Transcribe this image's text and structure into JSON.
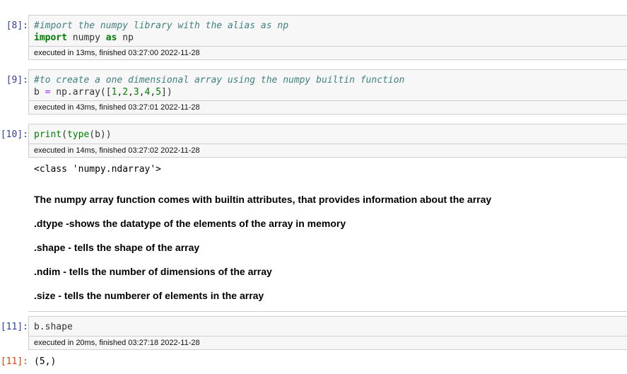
{
  "cells": [
    {
      "prompt": "[8]:",
      "comment": "#import the numpy library with the alias as np",
      "kw_import": "import",
      "mod": " numpy ",
      "kw_as": "as",
      "alias": " np",
      "exec": "executed in 13ms, finished 03:27:00 2022-11-28"
    },
    {
      "prompt": "[9]:",
      "comment": "#to create a one dimensional array using the numpy builtin function",
      "var": "b ",
      "op": "=",
      "call": " np.array([",
      "n1": "1",
      "n2": "2",
      "n3": "3",
      "n4": "4",
      "n5": "5",
      "comma": ",",
      "close": "])",
      "exec": "executed in 43ms, finished 03:27:01 2022-11-28"
    },
    {
      "prompt": "[10]:",
      "fn_print": "print",
      "open": "(",
      "fn_type": "type",
      "rest": "(b))",
      "exec": "executed in 14ms, finished 03:27:02 2022-11-28",
      "output": "<class 'numpy.ndarray'>"
    },
    {
      "prompt": "[11]:",
      "code": "b.shape",
      "exec": "executed in 20ms, finished 03:27:18 2022-11-28",
      "out_prompt": "[11]:",
      "output": "(5,)"
    }
  ],
  "markdown": [
    "The numpy array function comes with builtin attributes, that provides information about the array",
    ".dtype -shows the datatype of the elements of the array in memory",
    ".shape - tells the shape of the array",
    ".ndim - tells the number of dimensions of the array",
    ".size - tells the numberer of elements in the array"
  ]
}
